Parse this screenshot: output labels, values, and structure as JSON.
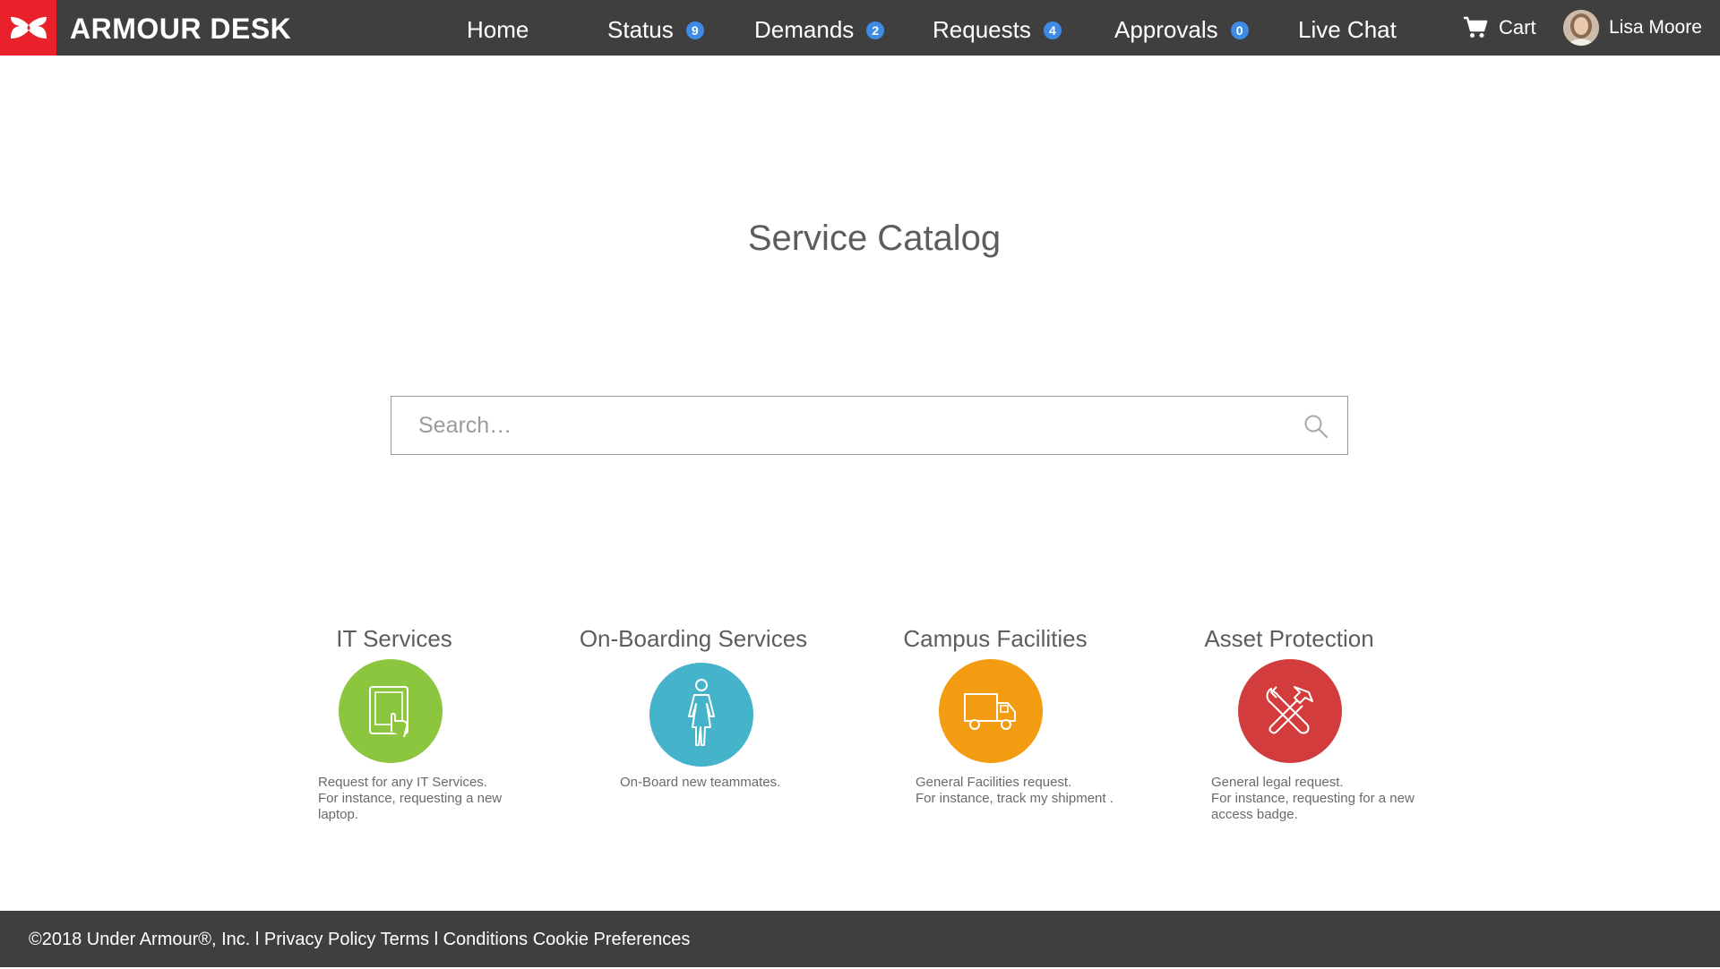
{
  "header": {
    "brand": "ARMOUR DESK",
    "nav": [
      {
        "label": "Home",
        "badge": null
      },
      {
        "label": "Status",
        "badge": "9"
      },
      {
        "label": "Demands",
        "badge": "2"
      },
      {
        "label": "Requests",
        "badge": "4"
      },
      {
        "label": "Approvals",
        "badge": "0"
      },
      {
        "label": "Live Chat",
        "badge": null
      }
    ],
    "cart_label": "Cart",
    "user_name": "Lisa Moore",
    "colors": {
      "bar": "#3f3f3f",
      "logo_bg": "#e8212a",
      "badge": "#3d8be5"
    }
  },
  "main": {
    "title": "Service Catalog",
    "search": {
      "placeholder": "Search…",
      "value": ""
    },
    "cards": [
      {
        "title": "IT Services",
        "icon": "tablet-touch-icon",
        "color": "#8cc63f",
        "desc": [
          "Request for any IT Services.",
          "For instance, requesting a new",
          "laptop."
        ]
      },
      {
        "title": "On-Boarding Services",
        "icon": "person-icon",
        "color": "#45b3c9",
        "desc": [
          "On-Board new teammates."
        ]
      },
      {
        "title": "Campus Facilities",
        "icon": "truck-icon",
        "color": "#f39c11",
        "desc": [
          "General Facilities request.",
          "For instance, track my shipment ."
        ]
      },
      {
        "title": "Asset Protection",
        "icon": "tools-icon",
        "color": "#d33c3c",
        "desc": [
          "General legal request.",
          "For instance, requesting for a new",
          "access badge."
        ]
      }
    ]
  },
  "footer": {
    "copyright": "©2018 Under Armour®, Inc. l ",
    "privacy": "Privacy Policy",
    "terms": "Terms l Conditions",
    "cookies": "Cookie Preferences"
  }
}
